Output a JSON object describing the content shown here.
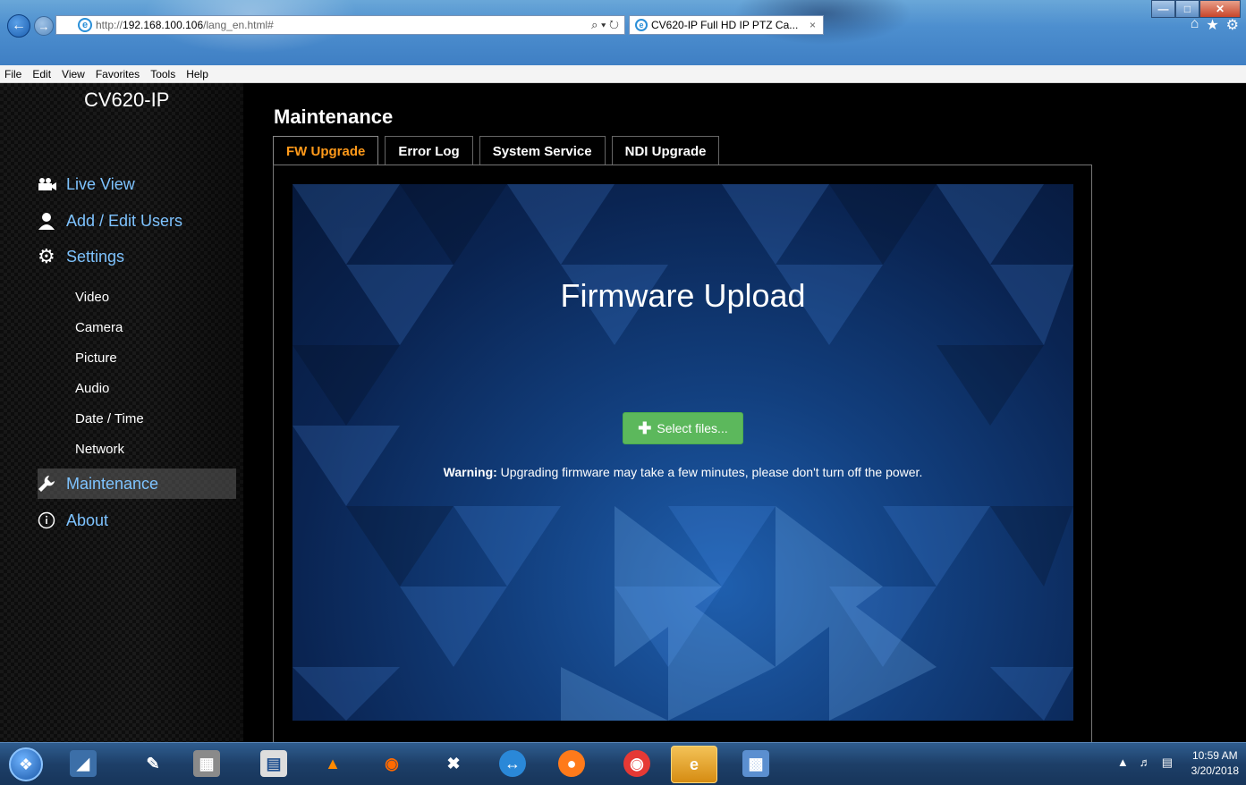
{
  "browser": {
    "url_prefix": "http://",
    "url_host": "192.168.100.106",
    "url_path": "/lang_en.html#",
    "tab_title": "CV620-IP Full HD IP PTZ Ca...",
    "tab_close": "×",
    "address_tools": "⌕ ▾ ↻"
  },
  "menu": [
    "File",
    "Edit",
    "View",
    "Favorites",
    "Tools",
    "Help"
  ],
  "sidebar": {
    "brand": "CV620-IP",
    "main_items": [
      {
        "label": "Live View",
        "icon": "camera-icon"
      },
      {
        "label": "Add / Edit Users",
        "icon": "user-icon"
      },
      {
        "label": "Settings",
        "icon": "gear-icon"
      }
    ],
    "sub_items": [
      "Video",
      "Camera",
      "Picture",
      "Audio",
      "Date / Time",
      "Network"
    ],
    "maintenance": {
      "label": "Maintenance",
      "icon": "wrench-icon"
    },
    "about": {
      "label": "About",
      "icon": "info-icon"
    }
  },
  "main": {
    "title": "Maintenance",
    "tabs": [
      "FW Upgrade",
      "Error Log",
      "System Service",
      "NDI Upgrade"
    ],
    "active_tab": "FW Upgrade",
    "hero_title": "Firmware Upload",
    "select_button": "Select files...",
    "warning_label": "Warning:",
    "warning_text": " Upgrading firmware may take a few minutes, please don't turn off the power."
  },
  "taskbar": {
    "time": "10:59 AM",
    "date": "3/20/2018"
  },
  "colors": {
    "active_tab": "#ff9a1a",
    "nav_link": "#7ec3ff",
    "select_button": "#5cb85c"
  }
}
